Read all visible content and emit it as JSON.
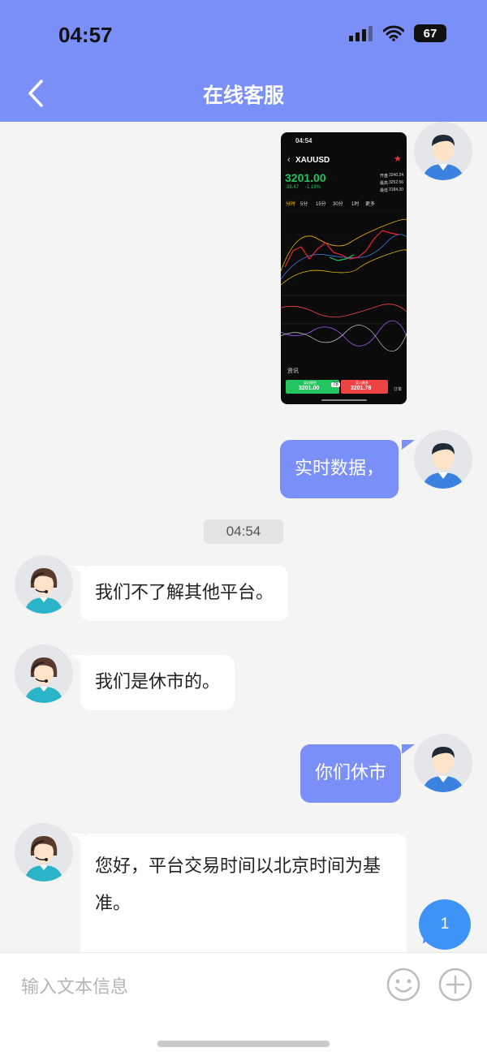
{
  "status_bar": {
    "time": "04:57",
    "battery": "67"
  },
  "header": {
    "title": "在线客服"
  },
  "screenshot": {
    "time": "04:54",
    "symbol": "XAUUSD",
    "price": "3201.00",
    "change": "-38.47",
    "change_pct": "-1.19%",
    "open_label": "开盘",
    "open": "3240.24",
    "high_label": "最高",
    "high": "3252.56",
    "low_label": "最低",
    "low": "3184.20",
    "tabs": [
      "分时",
      "5分",
      "15分",
      "30分",
      "1时",
      "更多"
    ],
    "section": "资讯",
    "sell_label": "卖出做空",
    "sell_price": "3201.00",
    "spread": "78",
    "buy_label": "买入做多",
    "buy_price": "3201.78",
    "order_label": "订单"
  },
  "messages": {
    "user_realtime": "实时数据，",
    "time_divider": "04:54",
    "agent_1": "我们不了解其他平台。",
    "agent_2": "我们是休市的。",
    "user_closed": "你们休市",
    "agent_3": "您好，平台交易时间以北京时间为基准。"
  },
  "unread_count": "1",
  "input": {
    "placeholder": "输入文本信息"
  },
  "icons": [
    "back-icon",
    "signal-icon",
    "wifi-icon",
    "battery-icon",
    "emoji-icon",
    "plus-icon"
  ]
}
